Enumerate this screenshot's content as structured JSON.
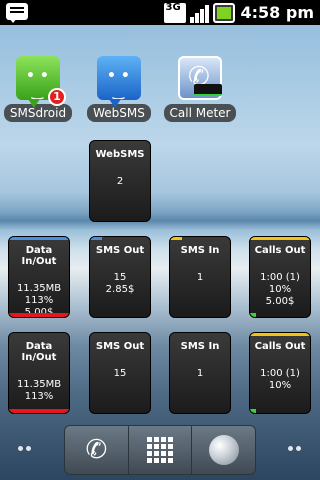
{
  "status_bar": {
    "time": "4:58 pm",
    "network": "3G",
    "icons": [
      "message-notification-icon",
      "3g-icon",
      "signal-icon",
      "battery-charging-icon"
    ]
  },
  "apps": [
    {
      "label": "SMSdroid",
      "icon": "green-chat-bubble-icon",
      "badge": "1"
    },
    {
      "label": "WebSMS",
      "icon": "blue-chat-bubble-icon"
    },
    {
      "label": "Call Meter",
      "icon": "phone-meter-icon"
    }
  ],
  "widgets": {
    "websms": {
      "title": "WebSMS",
      "lines": [
        "2"
      ]
    },
    "row1": [
      {
        "title": "Data In/Out",
        "lines": [
          "11.35MB",
          "113%",
          "5.00$"
        ],
        "top_color": "#4a90e2",
        "bottom_color": "#e5161d"
      },
      {
        "title": "SMS Out",
        "lines": [
          "15",
          "2.85$"
        ],
        "top_color": "#4a90e2",
        "bottom_color": ""
      },
      {
        "title": "SMS In",
        "lines": [
          "1"
        ],
        "top_color": "#f0c419",
        "bottom_color": ""
      },
      {
        "title": "Calls Out",
        "lines": [
          "1:00 (1)",
          "10%",
          "5.00$"
        ],
        "top_color": "#f0c419",
        "bottom_color": "#3bd13b"
      }
    ],
    "row2": [
      {
        "title": "Data In/Out",
        "lines": [
          "11.35MB",
          "113%"
        ],
        "top_color": "",
        "bottom_color": "#e5161d"
      },
      {
        "title": "SMS Out",
        "lines": [
          "15"
        ],
        "top_color": "",
        "bottom_color": ""
      },
      {
        "title": "SMS In",
        "lines": [
          "1"
        ],
        "top_color": "",
        "bottom_color": ""
      },
      {
        "title": "Calls Out",
        "lines": [
          "1:00 (1)",
          "10%"
        ],
        "top_color": "#f0c419",
        "bottom_color": "#3bd13b"
      }
    ]
  },
  "dock": [
    "phone-icon",
    "app-drawer-grid-icon",
    "browser-globe-icon"
  ]
}
